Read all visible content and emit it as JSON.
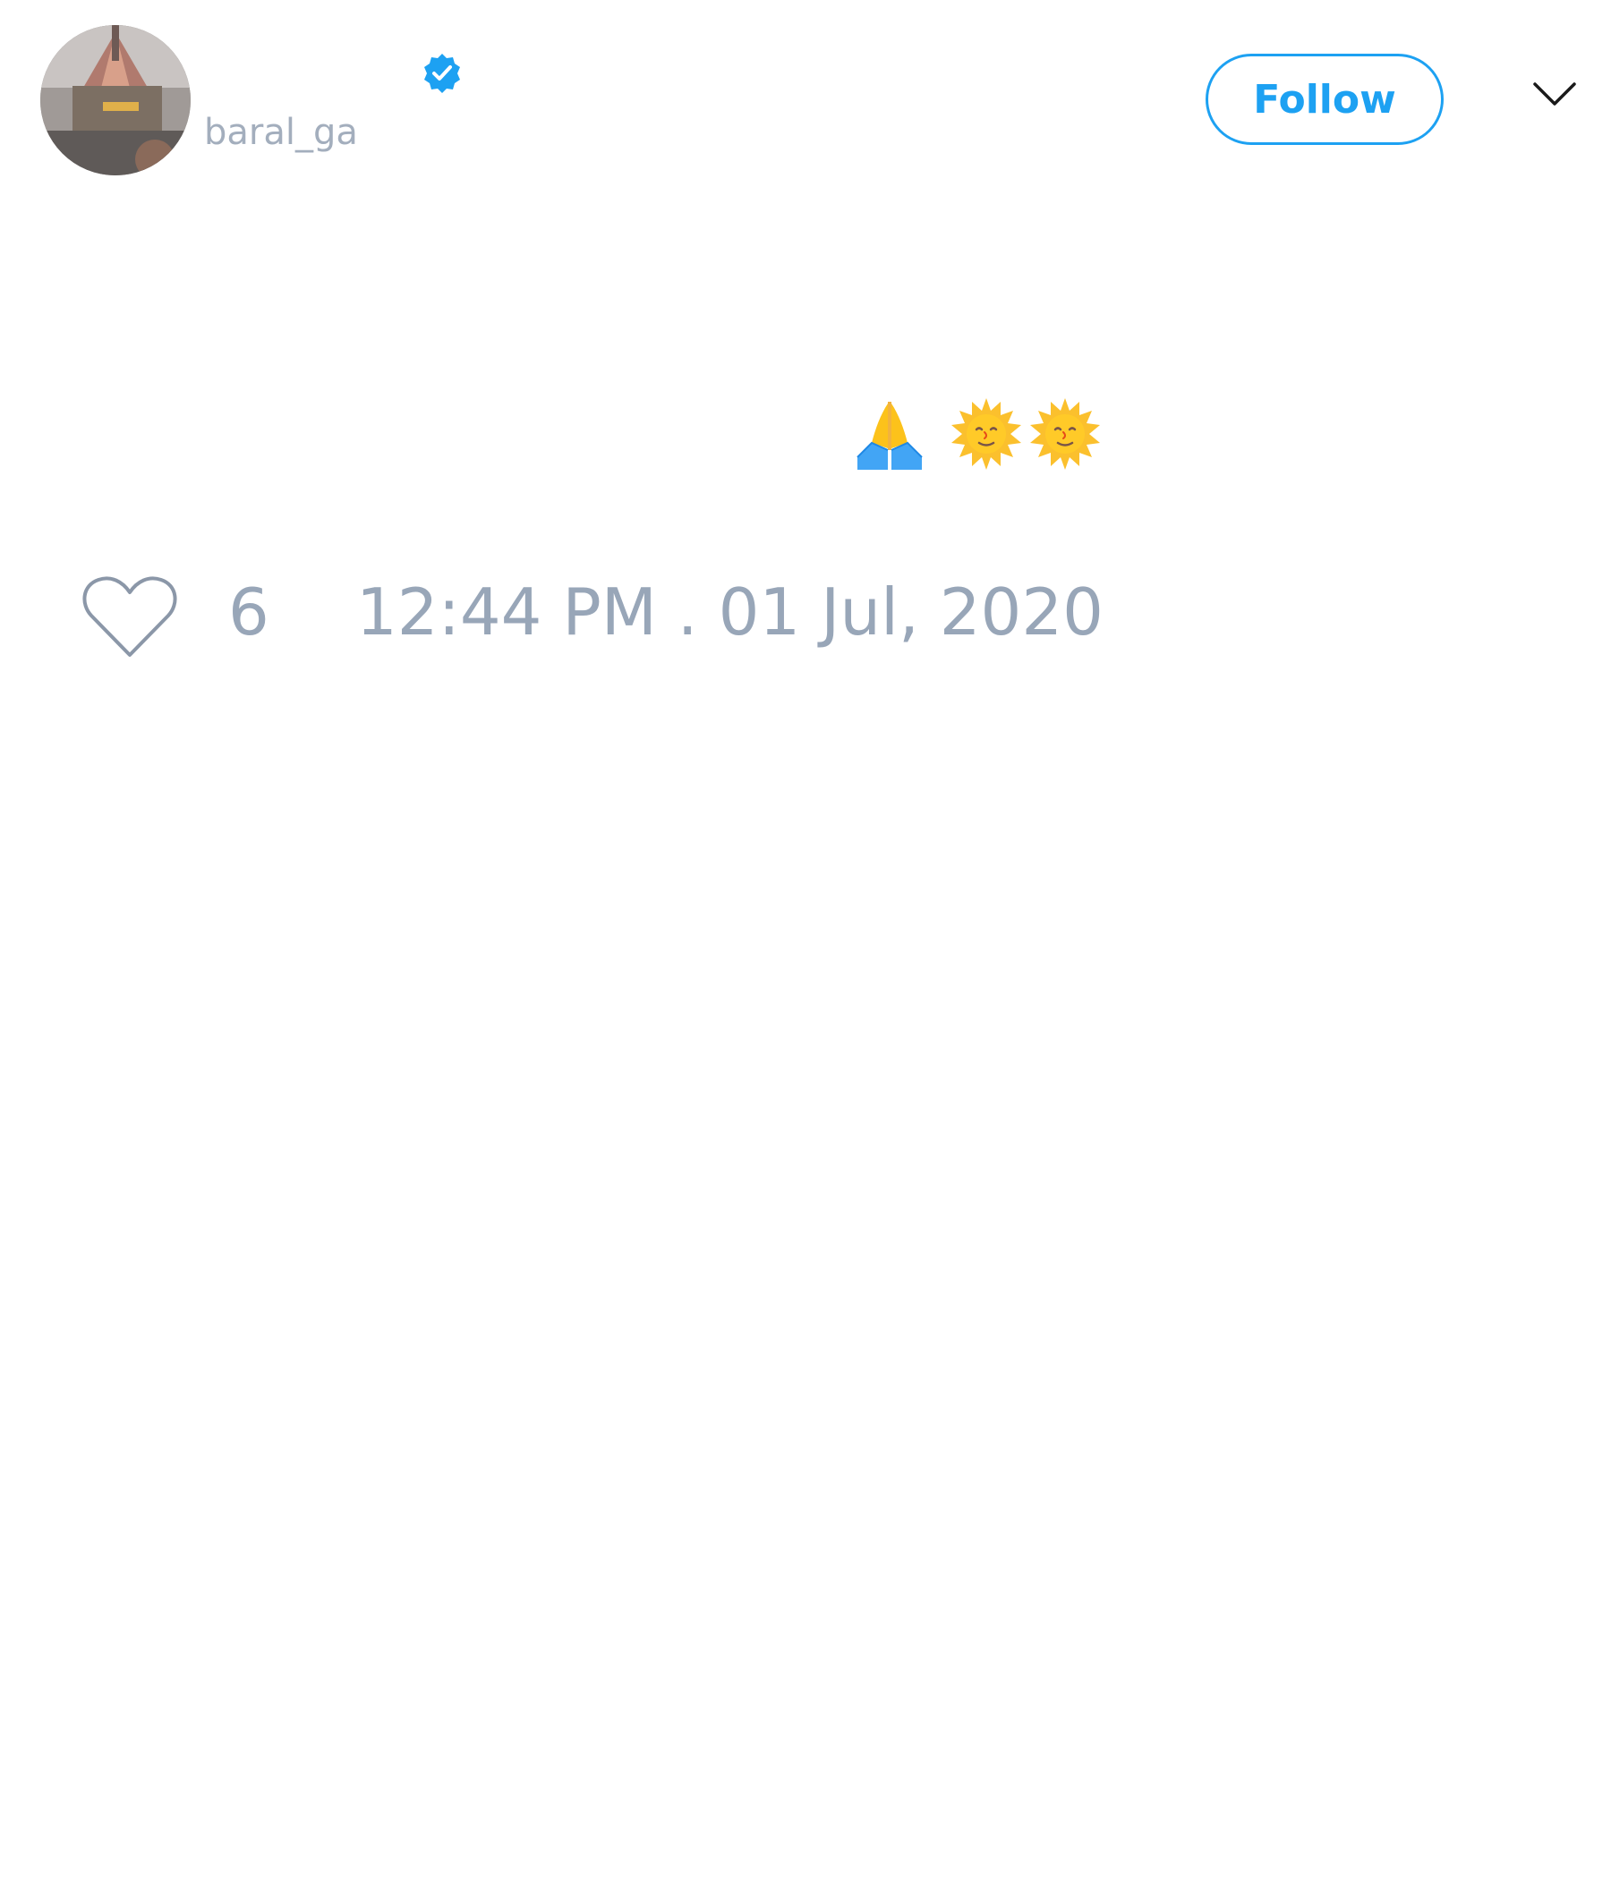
{
  "tweet": {
    "author": {
      "handle": "baral_ga",
      "verified": true,
      "avatar_icon": "avatar-photo"
    },
    "follow_button": {
      "label": "Follow",
      "color": "#1da1f2"
    },
    "menu_icon": "chevron-down-icon",
    "text_emojis": [
      "folded-hands-emoji",
      "sun-with-face-emoji",
      "sun-with-face-emoji"
    ],
    "like_icon": "heart-icon",
    "like_count": "6",
    "timestamp": "12:44 PM . 01 Jul, 2020"
  },
  "colors": {
    "accent": "#1da1f2",
    "muted_text": "#98a6b8",
    "handle_text": "#a3aebd"
  }
}
